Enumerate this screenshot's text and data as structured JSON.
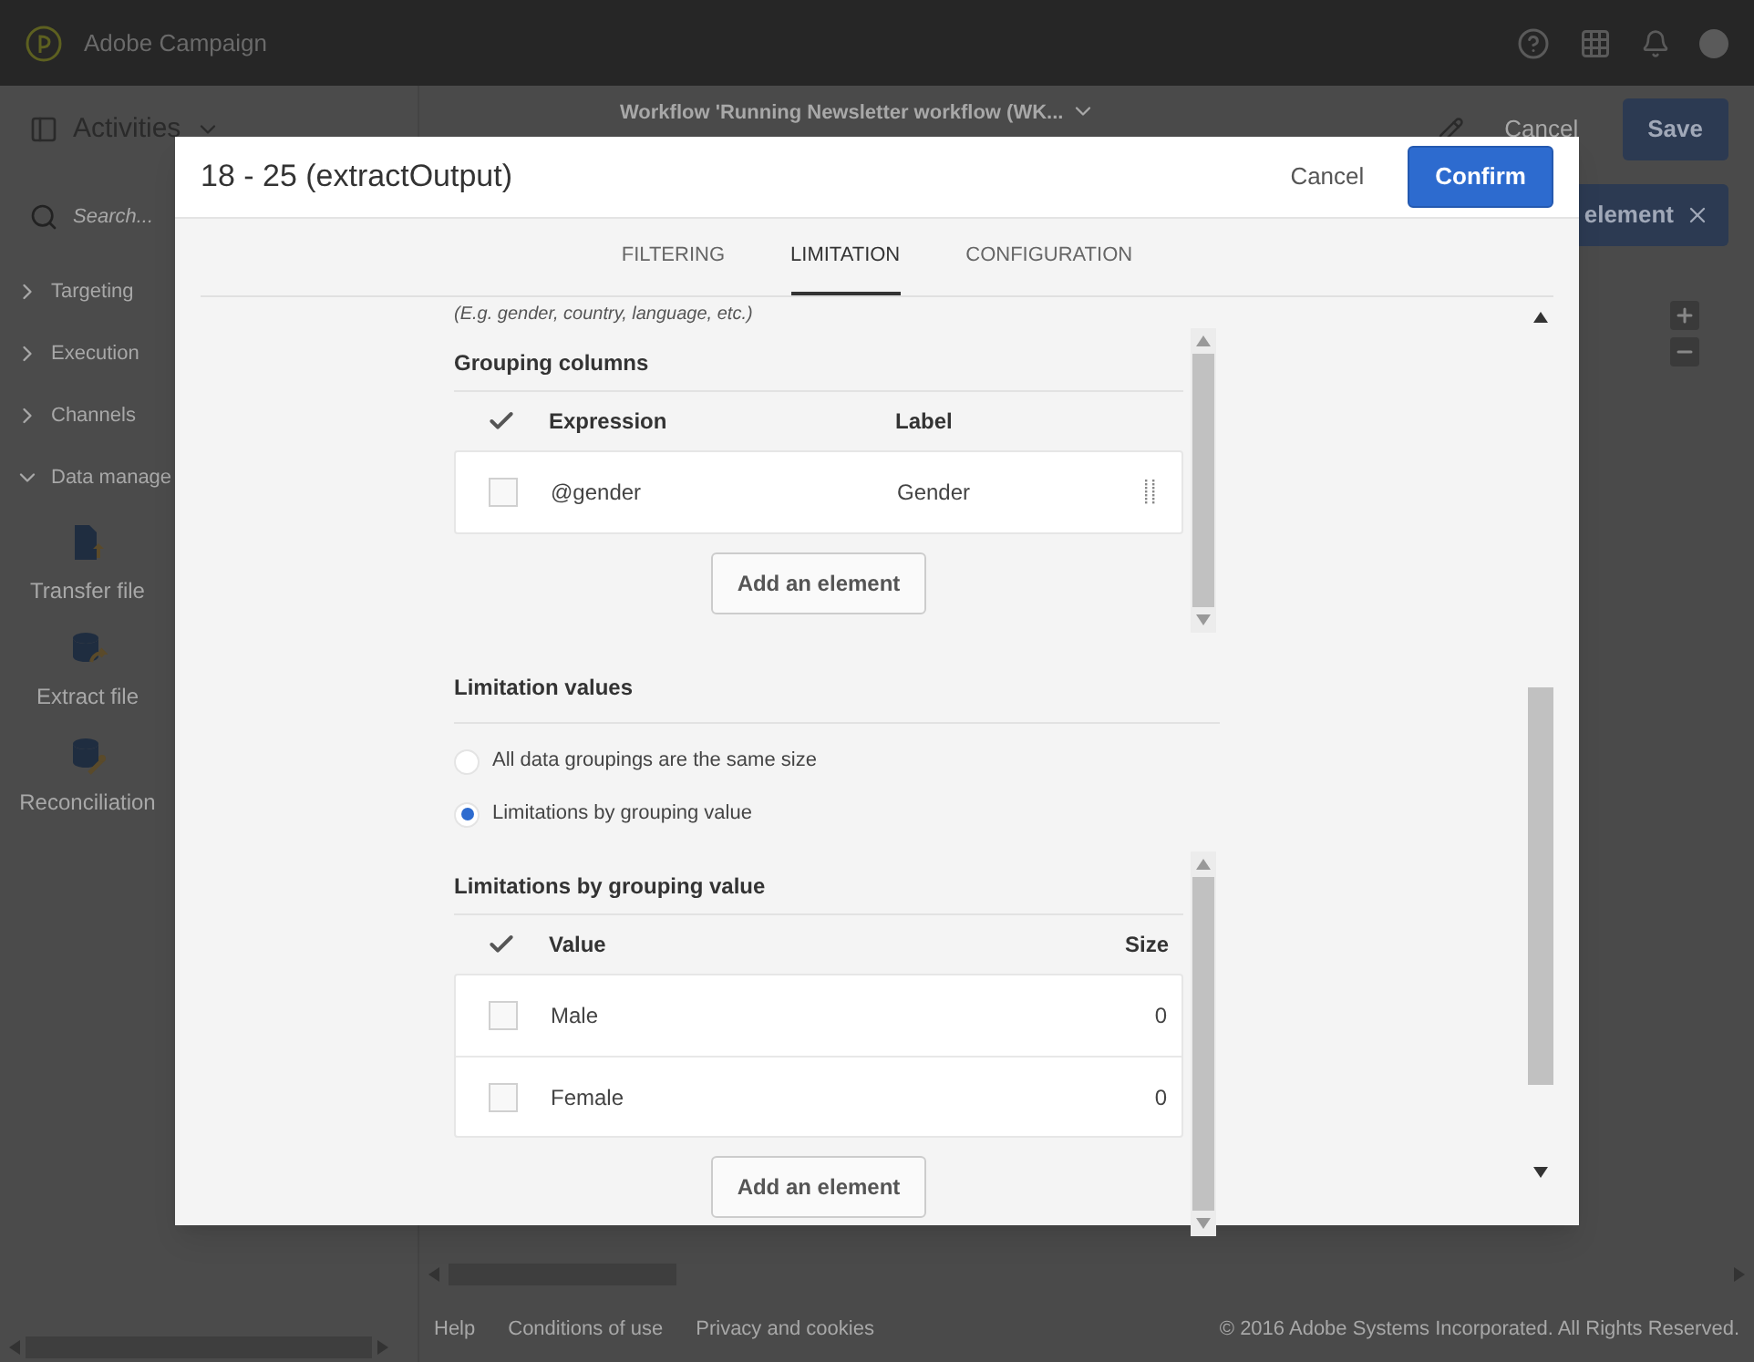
{
  "app": {
    "name": "Adobe Campaign"
  },
  "toolbar": {
    "panel_title": "Activities",
    "workflow_title": "Workflow 'Running Newsletter workflow (WK...",
    "cancel": "Cancel",
    "save": "Save",
    "add_element": "element"
  },
  "sidebar": {
    "search_placeholder": "Search...",
    "categories": [
      {
        "label": "Targeting",
        "expanded": false
      },
      {
        "label": "Execution",
        "expanded": false
      },
      {
        "label": "Channels",
        "expanded": false
      },
      {
        "label": "Data manage",
        "expanded": true,
        "children": [
          {
            "label": "Transfer file",
            "kind": "transfer"
          },
          {
            "label": "Extract file",
            "kind": "extract"
          },
          {
            "label": "Reconciliation",
            "kind": "reconcile"
          }
        ]
      }
    ]
  },
  "footer": {
    "links": [
      "Help",
      "Conditions of use",
      "Privacy and cookies"
    ],
    "copyright": "© 2016 Adobe Systems Incorporated. All Rights Reserved."
  },
  "dialog": {
    "title": "18 - 25 (extractOutput)",
    "cancel": "Cancel",
    "confirm": "Confirm",
    "tabs": [
      {
        "label": "FILTERING",
        "selected": false
      },
      {
        "label": "LIMITATION",
        "selected": true
      },
      {
        "label": "CONFIGURATION",
        "selected": false
      }
    ],
    "hint": "(E.g. gender, country, language, etc.)",
    "grouping": {
      "title": "Grouping columns",
      "columns": [
        "Expression",
        "Label"
      ],
      "rows": [
        {
          "cells": [
            "@gender",
            "Gender"
          ],
          "checked": false
        }
      ],
      "add": "Add an element"
    },
    "limitation_values": {
      "title": "Limitation values",
      "options": [
        {
          "label": "All data groupings are the same size",
          "selected": false
        },
        {
          "label": "Limitations by grouping value",
          "selected": true
        }
      ]
    },
    "limits": {
      "title": "Limitations by grouping value",
      "columns": [
        "Value",
        "Size"
      ],
      "rows": [
        {
          "cells": [
            "Male",
            "0"
          ],
          "checked": false
        },
        {
          "cells": [
            "Female",
            "0"
          ],
          "checked": false
        }
      ],
      "add": "Add an element"
    }
  }
}
